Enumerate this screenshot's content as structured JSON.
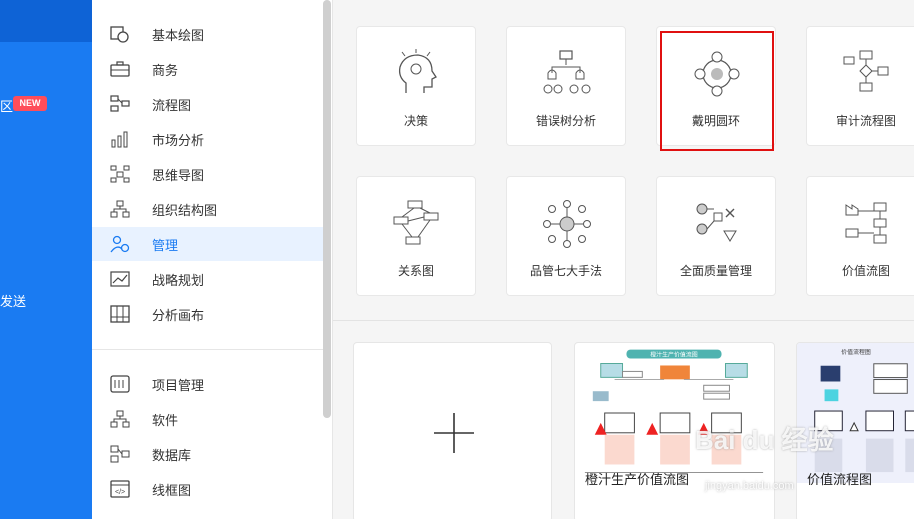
{
  "rail": {
    "item1_partial": "⁠",
    "new_badge": "NEW",
    "item2_partial": "发送"
  },
  "sidebar": {
    "groups": [
      {
        "label": "基本绘图",
        "icon": "basic-shapes-icon"
      },
      {
        "label": "商务",
        "icon": "briefcase-icon"
      },
      {
        "label": "流程图",
        "icon": "flowchart-icon"
      },
      {
        "label": "市场分析",
        "icon": "bar-chart-icon"
      },
      {
        "label": "思维导图",
        "icon": "mindmap-icon"
      },
      {
        "label": "组织结构图",
        "icon": "org-chart-icon"
      },
      {
        "label": "管理",
        "icon": "people-gear-icon",
        "active": true
      },
      {
        "label": "战略规划",
        "icon": "trend-chart-icon"
      },
      {
        "label": "分析画布",
        "icon": "canvas-grid-icon"
      },
      {
        "label": "项目管理",
        "icon": "gantt-icon"
      },
      {
        "label": "软件",
        "icon": "software-tree-icon"
      },
      {
        "label": "数据库",
        "icon": "database-icon"
      },
      {
        "label": "线框图",
        "icon": "wireframe-icon"
      }
    ]
  },
  "templates": [
    {
      "label": "决策",
      "icon": "head-decision-icon"
    },
    {
      "label": "错误树分析",
      "icon": "fault-tree-icon"
    },
    {
      "label": "戴明圆环",
      "icon": "deming-cycle-icon",
      "highlighted": true
    },
    {
      "label": "审计流程图",
      "icon": "audit-flow-icon"
    },
    {
      "label": "关系图",
      "icon": "relation-diagram-icon"
    },
    {
      "label": "品管七大手法",
      "icon": "hub-spoke-icon"
    },
    {
      "label": "全面质量管理",
      "icon": "tqm-icon"
    },
    {
      "label": "价值流图",
      "icon": "value-stream-icon"
    }
  ],
  "examples": [
    {
      "label": "新建空白",
      "icon": "plus-icon"
    },
    {
      "label": "橙汁生产价值流图",
      "thumb_title": "橙汁生产价值流图"
    },
    {
      "label": "价值流程图",
      "thumb_title": "价值流程图"
    }
  ],
  "watermark": {
    "main": "Bai du 经验",
    "sub": "jingyan.baidu.com"
  },
  "colors": {
    "accent": "#1a7bf2",
    "highlight": "#e01010",
    "rail": "#1a7bf2"
  }
}
